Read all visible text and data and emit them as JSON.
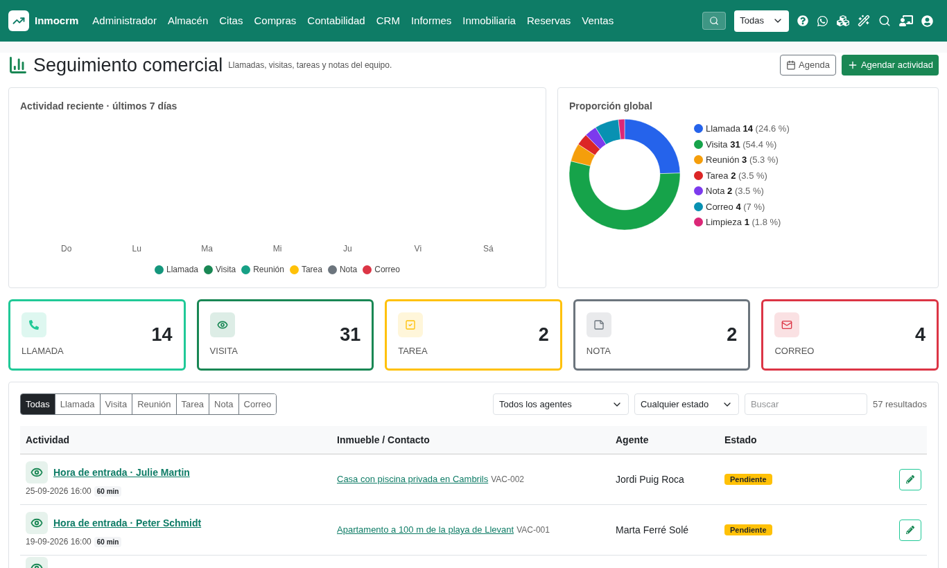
{
  "navbar": {
    "brand": "Inmocrm",
    "menu": [
      "Administrador",
      "Almacén",
      "Citas",
      "Compras",
      "Contabilidad",
      "CRM",
      "Informes",
      "Inmobiliaria",
      "Reservas",
      "Ventas"
    ],
    "scope_select": "Todas"
  },
  "header": {
    "title": "Seguimiento comercial",
    "subtitle": "Llamadas, visitas, tareas y notas del equipo.",
    "buttons": [
      {
        "label": "Agenda",
        "kind": "outline"
      },
      {
        "label": "Agendar actividad",
        "kind": "primary"
      }
    ]
  },
  "recent_panel": {
    "title": "Actividad reciente · últimos 7 días",
    "days": [
      "Do",
      "Lu",
      "Ma",
      "Mi",
      "Ju",
      "Vi",
      "Sá"
    ],
    "legend": [
      {
        "label": "Llamada",
        "color": "#14967c"
      },
      {
        "label": "Visita",
        "color": "#198754"
      },
      {
        "label": "Reunión",
        "color": "#16a085"
      },
      {
        "label": "Tarea",
        "color": "#ffc107"
      },
      {
        "label": "Nota",
        "color": "#6c757d"
      },
      {
        "label": "Correo",
        "color": "#dc3545"
      }
    ]
  },
  "share_panel": {
    "title": "Proporción global",
    "chart_data": {
      "type": "donut",
      "categories": [
        "Llamada",
        "Visita",
        "Reunión",
        "Tarea",
        "Nota",
        "Correo",
        "Limpieza"
      ],
      "values": [
        24.6,
        54.4,
        5.3,
        3.5,
        3.5,
        7,
        1.8
      ]
    },
    "legend": [
      {
        "count": "14",
        "percent": "(24.6 %)",
        "color": "#2563eb"
      },
      {
        "count": "31",
        "percent": "(54.4 %)",
        "color": "#16a34a"
      },
      {
        "count": "3",
        "percent": "(5.3 %)",
        "color": "#f59e0b"
      },
      {
        "count": "2",
        "percent": "(3.5 %)",
        "color": "#dc2626"
      },
      {
        "count": "2",
        "percent": "(3.5 %)",
        "color": "#7c3aed"
      },
      {
        "count": "4",
        "percent": "(7 %)",
        "color": "#0891b2"
      },
      {
        "count": "1",
        "percent": "(1.8 %)",
        "color": "#db2777"
      }
    ]
  },
  "stat_cards": [
    {
      "kind": "phone",
      "label": "LLAMADA",
      "value": "14",
      "color": "#20c997"
    },
    {
      "kind": "eye",
      "label": "VISITA",
      "value": "31",
      "color": "#198754"
    },
    {
      "kind": "check",
      "label": "TAREA",
      "value": "2",
      "color": "#ffc107"
    },
    {
      "kind": "note",
      "label": "NOTA",
      "value": "2",
      "color": "#6c757d"
    },
    {
      "kind": "mail",
      "label": "CORREO",
      "value": "4",
      "color": "#dc3545"
    }
  ],
  "activity": {
    "filters": [
      {
        "label": "Todas",
        "selected": true
      },
      {
        "label": "Llamada",
        "selected": false
      },
      {
        "label": "Visita",
        "selected": false
      },
      {
        "label": "Reunión",
        "selected": false
      },
      {
        "label": "Tarea",
        "selected": false
      },
      {
        "label": "Nota",
        "selected": false
      },
      {
        "label": "Correo",
        "selected": false
      }
    ],
    "agent_select": "Todos los agentes",
    "status_select": "Cualquier estado",
    "search_placeholder": "Buscar",
    "result_count": "57 resultados",
    "columns": [
      "Actividad",
      "Inmueble / Contacto",
      "Agente",
      "Estado"
    ],
    "rows": [
      {
        "kind": "eye",
        "title": "Hora de entrada · Julie Martin",
        "date": "25-09-2026 16:00",
        "duration": "60 min",
        "property": "Casa con piscina privada en Cambrils",
        "ref": "VAC-002",
        "agent": "Jordi Puig Roca",
        "status": "Pendiente"
      },
      {
        "kind": "eye",
        "title": "Hora de entrada · Peter Schmidt",
        "date": "19-09-2026 16:00",
        "duration": "60 min",
        "property": "Apartamento a 100 m de la playa de Llevant",
        "ref": "VAC-001",
        "agent": "Marta Ferré Solé",
        "status": "Pendiente"
      },
      {
        "kind": "eye"
      }
    ]
  }
}
